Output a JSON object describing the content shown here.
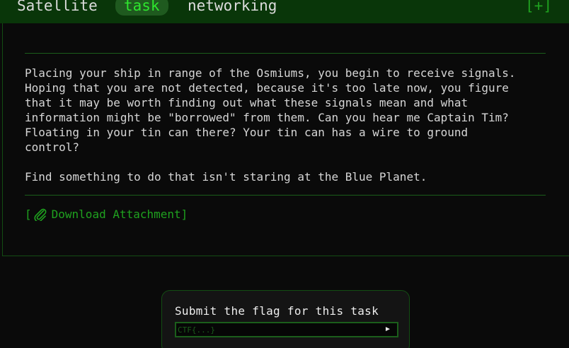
{
  "header": {
    "tags": [
      "Satellite",
      "task",
      "networking"
    ],
    "expand_label": "[+]"
  },
  "challenge": {
    "description": "Placing your ship in range of the Osmiums, you begin to receive signals.\nHoping that you are not detected, because it's too late now, you figure\nthat it may be worth finding out what these signals mean and what\ninformation might be \"borrowed\" from them. Can you hear me Captain Tim?\nFloating in your tin can there? Your tin can has a wire to ground\ncontrol?\n\nFind something to do that isn't staring at the Blue Planet.",
    "attachment": {
      "open_bracket": "[",
      "label": "Download Attachment",
      "close_bracket": "]",
      "icon": "paperclip-icon"
    }
  },
  "submit": {
    "title": "Submit the flag for this task",
    "placeholder": "CTF{...}",
    "value": "",
    "button_label": "►"
  },
  "colors": {
    "background": "#0a0a0a",
    "header": "#093609",
    "accent": "#1fa11f",
    "active_tag": "#2ee62e",
    "active_tag_bg": "#1f5a1f",
    "border": "#134d13"
  }
}
